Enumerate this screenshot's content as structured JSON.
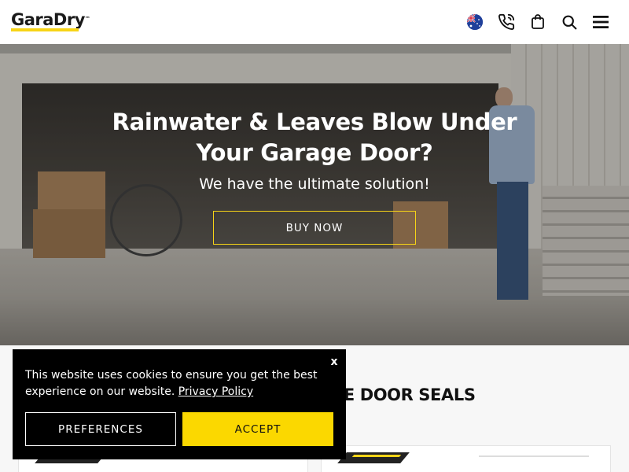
{
  "header": {
    "logo_text": "GaraDry",
    "logo_tm": "™",
    "icons": [
      "australia-flag-icon",
      "phone-icon",
      "shopping-bag-icon",
      "search-icon",
      "hamburger-menu-icon"
    ]
  },
  "hero": {
    "title": "Rainwater & Leaves Blow Under Your Garage Door?",
    "subtitle": "We have the ultimate solution!",
    "button_label": "BUY NOW"
  },
  "section": {
    "title_visible": "GE DOOR SEALS"
  },
  "cookie": {
    "text": "This website uses cookies to ensure you get the best experience on our website.",
    "link_label": "Privacy Policy",
    "close_label": "x",
    "preferences_label": "PREFERENCES",
    "accept_label": "ACCEPT"
  },
  "colors": {
    "brand_yellow": "#f7d417",
    "accept_yellow": "#fbd800",
    "banner_bg": "#000000"
  }
}
